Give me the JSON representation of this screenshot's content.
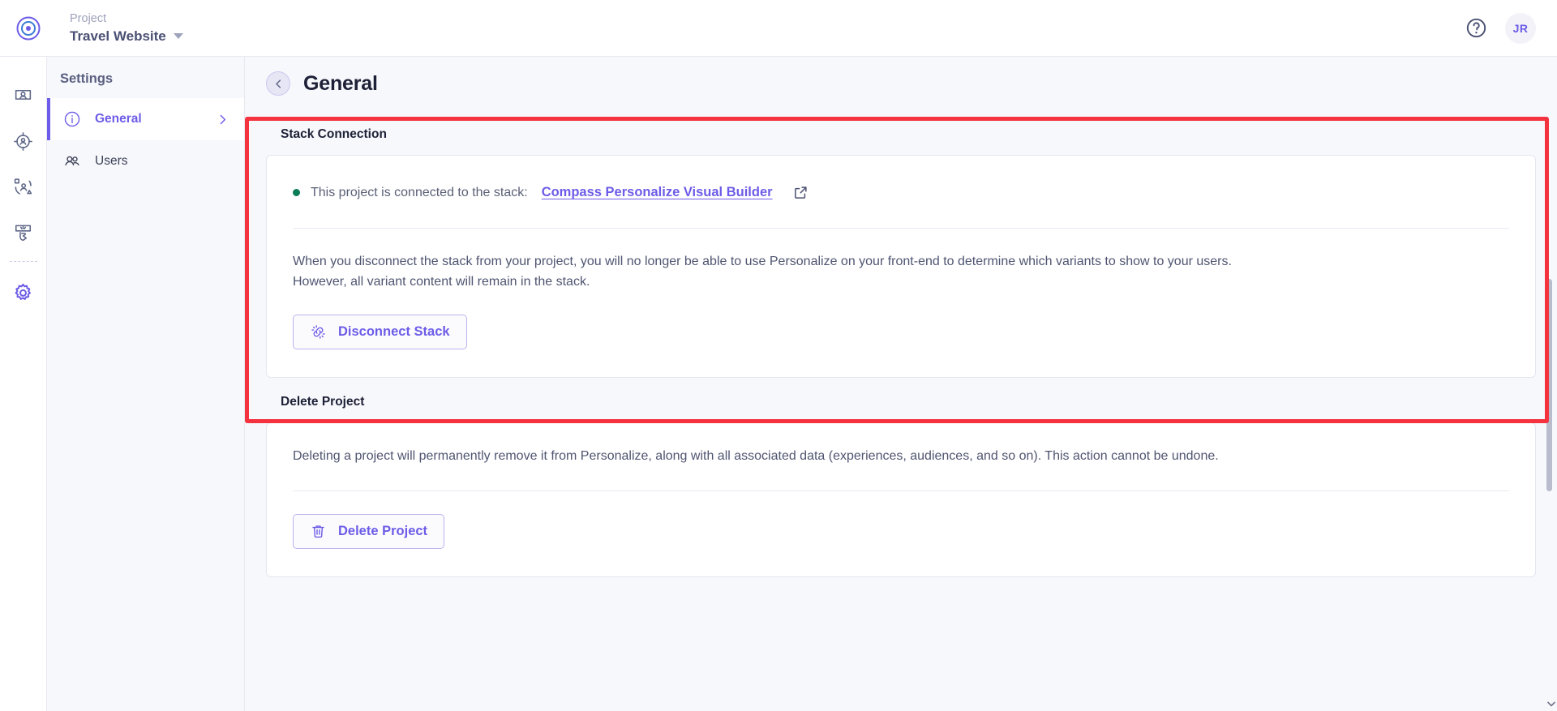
{
  "topbar": {
    "logo_icon": "target-circle-logo",
    "project_label": "Project",
    "project_name": "Travel Website",
    "dropdown_icon": "caret-down-icon",
    "help_icon": "help-circle-icon",
    "avatar_initials": "JR"
  },
  "rail": {
    "items": [
      {
        "icon": "audience-screen-icon",
        "name": "audiences"
      },
      {
        "icon": "target-person-icon",
        "name": "experiences"
      },
      {
        "icon": "segments-person-icon",
        "name": "segments"
      },
      {
        "icon": "click-cursor-icon",
        "name": "events"
      },
      {
        "icon": "gear-icon",
        "name": "settings",
        "active": true
      }
    ]
  },
  "settings_nav": {
    "title": "Settings",
    "items": [
      {
        "label": "General",
        "icon": "info-circle-icon",
        "active": true,
        "chevron": "chevron-right-icon"
      },
      {
        "label": "Users",
        "icon": "users-icon",
        "active": false
      }
    ]
  },
  "main": {
    "back_icon": "chevron-left-icon",
    "page_title": "General",
    "stack_connection": {
      "section_title": "Stack Connection",
      "status_dot_color": "#0b7d54",
      "status_text": "This project is connected to the stack:",
      "stack_link": "Compass Personalize Visual Builder",
      "external_link_icon": "external-link-icon",
      "description": "When you disconnect the stack from your project, you will no longer be able to use Personalize on your front-end to determine which variants to show to your users. However, all variant content will remain in the stack.",
      "button_label": "Disconnect Stack",
      "button_icon": "broken-link-icon"
    },
    "delete_project": {
      "section_title": "Delete Project",
      "description": "Deleting a project will permanently remove it from Personalize, along with all associated data (experiences, audiences, and so on). This action cannot be undone.",
      "button_label": "Delete Project",
      "button_icon": "trash-icon"
    }
  },
  "annotation": {
    "color": "#f5333f"
  },
  "colors": {
    "accent_purple": "#6c5ce7",
    "status_green": "#0b7d54",
    "annotation_red": "#f5333f",
    "panel_bg": "#f7f8fc"
  }
}
